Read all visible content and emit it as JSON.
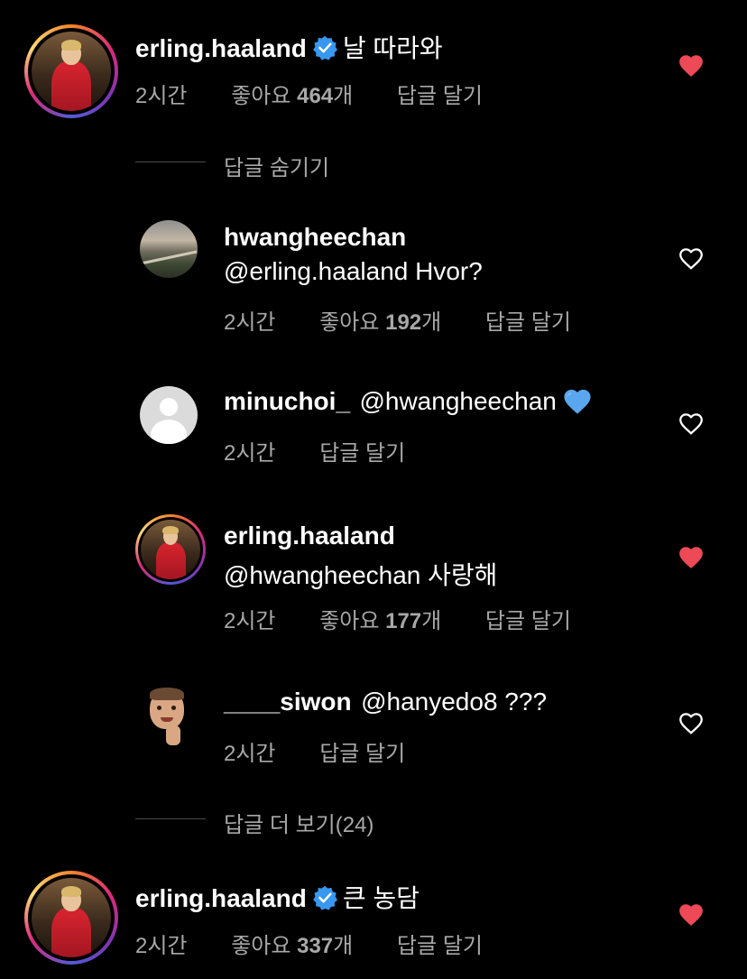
{
  "comments": [
    {
      "username": "erling.haaland",
      "verified": true,
      "text": "날 따라와",
      "time": "2시간",
      "likes_prefix": "좋아요 ",
      "likes_count": "464",
      "likes_suffix": "개",
      "reply": "답글 달기",
      "liked": true
    },
    {
      "username": "erling.haaland",
      "verified": true,
      "text": "큰 농담",
      "time": "2시간",
      "likes_prefix": "좋아요 ",
      "likes_count": "337",
      "likes_suffix": "개",
      "reply": "답글 달기",
      "liked": true
    }
  ],
  "hide_replies": "답글 숨기기",
  "more_replies": "답글 더 보기(24)",
  "replies": [
    {
      "username": "hwangheechan",
      "text": "@erling.haaland Hvor?",
      "time": "2시간",
      "likes_prefix": "좋아요 ",
      "likes_count": "192",
      "likes_suffix": "개",
      "reply": "답글 달기",
      "liked": false
    },
    {
      "username": "minuchoi_",
      "text": "@hwangheechan",
      "emoji": "blue-heart",
      "time": "2시간",
      "reply": "답글 달기",
      "liked": false
    },
    {
      "username": "erling.haaland",
      "text": "@hwangheechan 사랑해",
      "time": "2시간",
      "likes_prefix": "좋아요 ",
      "likes_count": "177",
      "likes_suffix": "개",
      "reply": "답글 달기",
      "liked": true
    },
    {
      "username": "____siwon",
      "text": "@hanyedo8 ???",
      "time": "2시간",
      "reply": "답글 달기",
      "liked": false
    }
  ],
  "colors": {
    "background": "#000000",
    "liked_heart": "#ed4956",
    "verified_badge": "#3897f0",
    "meta_text": "#a8a8a8"
  }
}
